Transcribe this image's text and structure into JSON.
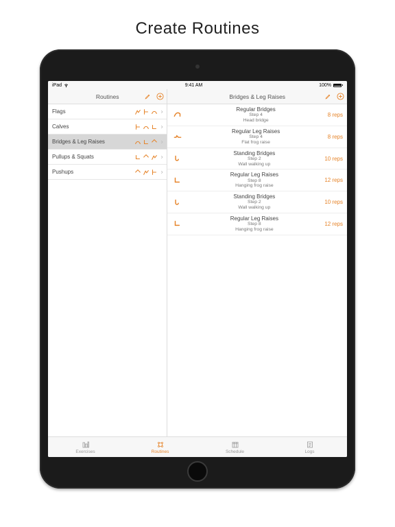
{
  "heading": "Create Routines",
  "status": {
    "device": "iPad",
    "time": "9:41 AM",
    "battery": "100%"
  },
  "leftPane": {
    "title": "Routines",
    "items": [
      {
        "label": "Flags",
        "selected": false
      },
      {
        "label": "Calves",
        "selected": false
      },
      {
        "label": "Bridges & Leg Raises",
        "selected": true
      },
      {
        "label": "Pullups & Squats",
        "selected": false
      },
      {
        "label": "Pushups",
        "selected": false
      }
    ]
  },
  "rightPane": {
    "title": "Bridges & Leg Raises",
    "items": [
      {
        "title": "Regular Bridges",
        "step": "Step 4",
        "sub": "Head bridge",
        "reps": "8 reps"
      },
      {
        "title": "Regular Leg Raises",
        "step": "Step 4",
        "sub": "Flat frog raise",
        "reps": "8 reps"
      },
      {
        "title": "Standing Bridges",
        "step": "Step 2",
        "sub": "Wall walking up",
        "reps": "10 reps"
      },
      {
        "title": "Regular Leg Raises",
        "step": "Step 8",
        "sub": "Hanging frog raise",
        "reps": "12 reps"
      },
      {
        "title": "Standing Bridges",
        "step": "Step 2",
        "sub": "Wall walking up",
        "reps": "10 reps"
      },
      {
        "title": "Regular Leg Raises",
        "step": "Step 8",
        "sub": "Hanging frog raise",
        "reps": "12 reps"
      }
    ]
  },
  "tabs": [
    {
      "label": "Exercises",
      "active": false
    },
    {
      "label": "Routines",
      "active": true
    },
    {
      "label": "Schedule",
      "active": false
    },
    {
      "label": "Logs",
      "active": false
    }
  ]
}
